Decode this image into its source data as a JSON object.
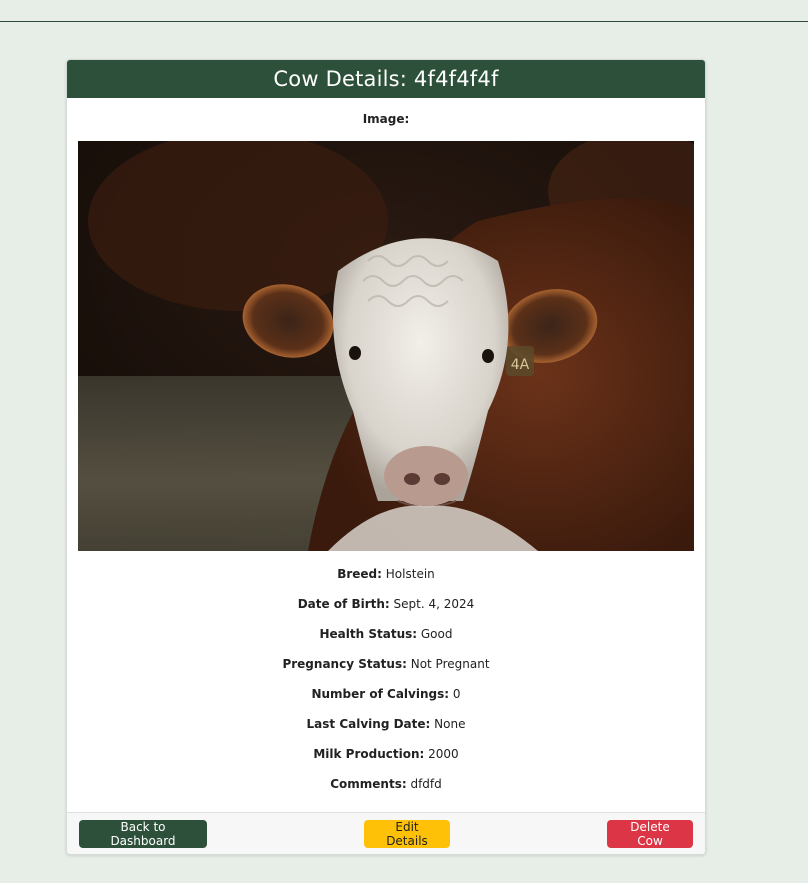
{
  "header": {
    "title": "Cow Details: 4f4f4f4f"
  },
  "image": {
    "label": "Image:",
    "subject": "hereford-cow-photo"
  },
  "details": [
    {
      "label": "Breed:",
      "value": "Holstein"
    },
    {
      "label": "Date of Birth:",
      "value": "Sept. 4, 2024"
    },
    {
      "label": "Health Status:",
      "value": "Good"
    },
    {
      "label": "Pregnancy Status:",
      "value": "Not Pregnant"
    },
    {
      "label": "Number of Calvings:",
      "value": "0"
    },
    {
      "label": "Last Calving Date:",
      "value": "None"
    },
    {
      "label": "Milk Production:",
      "value": "2000"
    },
    {
      "label": "Comments:",
      "value": "dfdfd"
    }
  ],
  "footer": {
    "back_label": "Back to Dashboard",
    "edit_label": "Edit Details",
    "delete_label": "Delete Cow"
  },
  "colors": {
    "brand_green": "#2c5039",
    "warning_yellow": "#ffc107",
    "danger_red": "#dc3545",
    "page_bg": "#e7eee8"
  },
  "ear_tag_text": "4A"
}
